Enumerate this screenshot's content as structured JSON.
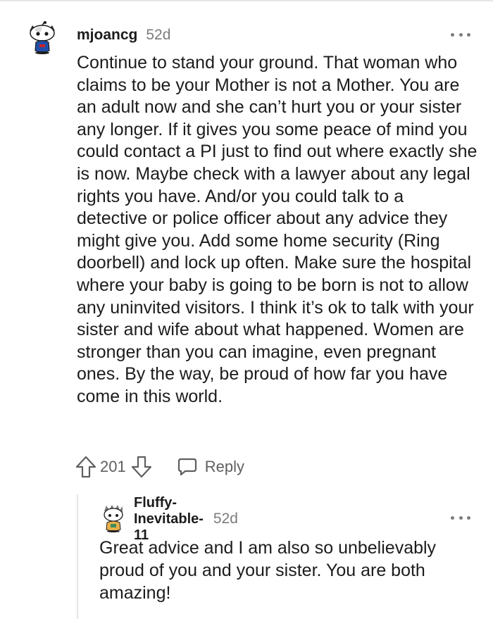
{
  "comment": {
    "author": "mjoancg",
    "age": "52d",
    "avatar": "snoo-avatar-icon",
    "body": "Continue to stand your ground. That woman who claims to be your Mother is not a Mother. You are an adult now and she can’t hurt you or your sister any longer. If it gives you some peace of mind you could contact a PI just to find out where exactly she is now. Maybe check with a lawyer about any legal rights you have. And/or you could talk to a detective or police officer about any advice they might give you. Add some home security (Ring doorbell) and lock up often. Make sure the hospital where your baby is going to be born is not to allow any uninvited visitors. I think it’s ok to talk with your sister and wife about what happened. Women are stronger than you can imagine, even pregnant ones. By the way, be proud of how far you have come in this world.",
    "score": "201",
    "reply_label": "Reply",
    "more_icon": "more-options-icon"
  },
  "reply": {
    "author": "Fluffy-Inevitable-11",
    "age": "52d",
    "avatar": "snoo-avatar-icon",
    "body": "Great advice and I am also so unbelievably proud of you and your sister. You are both amazing!",
    "more_icon": "more-options-icon"
  },
  "colors": {
    "text": "#1c1c1c",
    "meta": "#7c7c7c",
    "action": "#5f5f5f",
    "divider": "#e4e6e8"
  }
}
